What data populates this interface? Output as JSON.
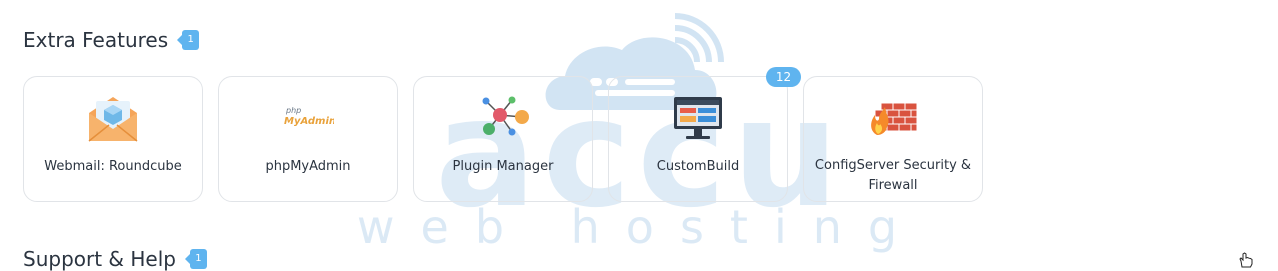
{
  "extra_features": {
    "title": "Extra Features",
    "badge": "1",
    "cards": [
      {
        "label": "Webmail: Roundcube",
        "icon": "mail-icon"
      },
      {
        "label": "phpMyAdmin",
        "icon": "phpmyadmin-icon",
        "logo_text_top": "php",
        "logo_text_bottom": "MyAdmin"
      },
      {
        "label": "Plugin Manager",
        "icon": "plugin-network-icon"
      },
      {
        "label": "CustomBuild",
        "icon": "monitor-icon",
        "count": "12"
      },
      {
        "label": "ConfigServer Security & Firewall",
        "icon": "firewall-icon"
      }
    ]
  },
  "support_help": {
    "title": "Support & Help",
    "badge": "1"
  },
  "watermark": {
    "brand": "accu",
    "tagline": "web hosting"
  },
  "colors": {
    "accent": "#5fb4ef",
    "watermark": "#a9c9e6",
    "text": "#2b3440",
    "card_border": "#e1e4e8"
  }
}
